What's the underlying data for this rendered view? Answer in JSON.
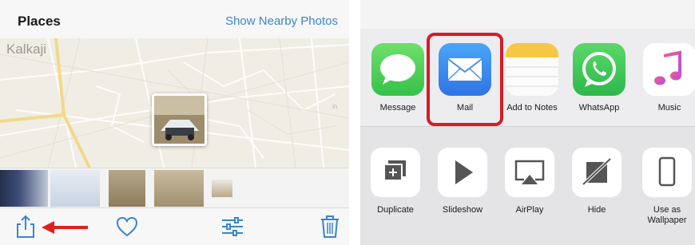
{
  "left_panel": {
    "title": "Places",
    "show_nearby_link": "Show Nearby Photos",
    "map": {
      "location_label": "Kalkaji"
    },
    "toolbar": {
      "icons": [
        "share-icon",
        "heart-icon",
        "adjust-icon",
        "trash-icon"
      ],
      "annotation_arrow_color": "#e02020"
    },
    "accent_color": "#3a86c8"
  },
  "right_panel": {
    "apps": [
      {
        "label": "Message",
        "icon": "message-icon",
        "color": "#4cd964"
      },
      {
        "label": "Mail",
        "icon": "mail-icon",
        "color": "#3c8cf0"
      },
      {
        "label": "Add to Notes",
        "icon": "notes-icon",
        "color": "#f6c744"
      },
      {
        "label": "WhatsApp",
        "icon": "whatsapp-icon",
        "color": "#3fcb5a"
      },
      {
        "label": "Music",
        "icon": "music-icon",
        "color": "#f2416e"
      }
    ],
    "actions": [
      {
        "label": "Duplicate",
        "icon": "duplicate-icon"
      },
      {
        "label": "Slideshow",
        "icon": "slideshow-icon"
      },
      {
        "label": "AirPlay",
        "icon": "airplay-icon"
      },
      {
        "label": "Hide",
        "icon": "hide-icon"
      },
      {
        "label": "Use as Wallpaper",
        "icon": "wallpaper-icon"
      }
    ],
    "highlight_color": "#d41d26"
  }
}
